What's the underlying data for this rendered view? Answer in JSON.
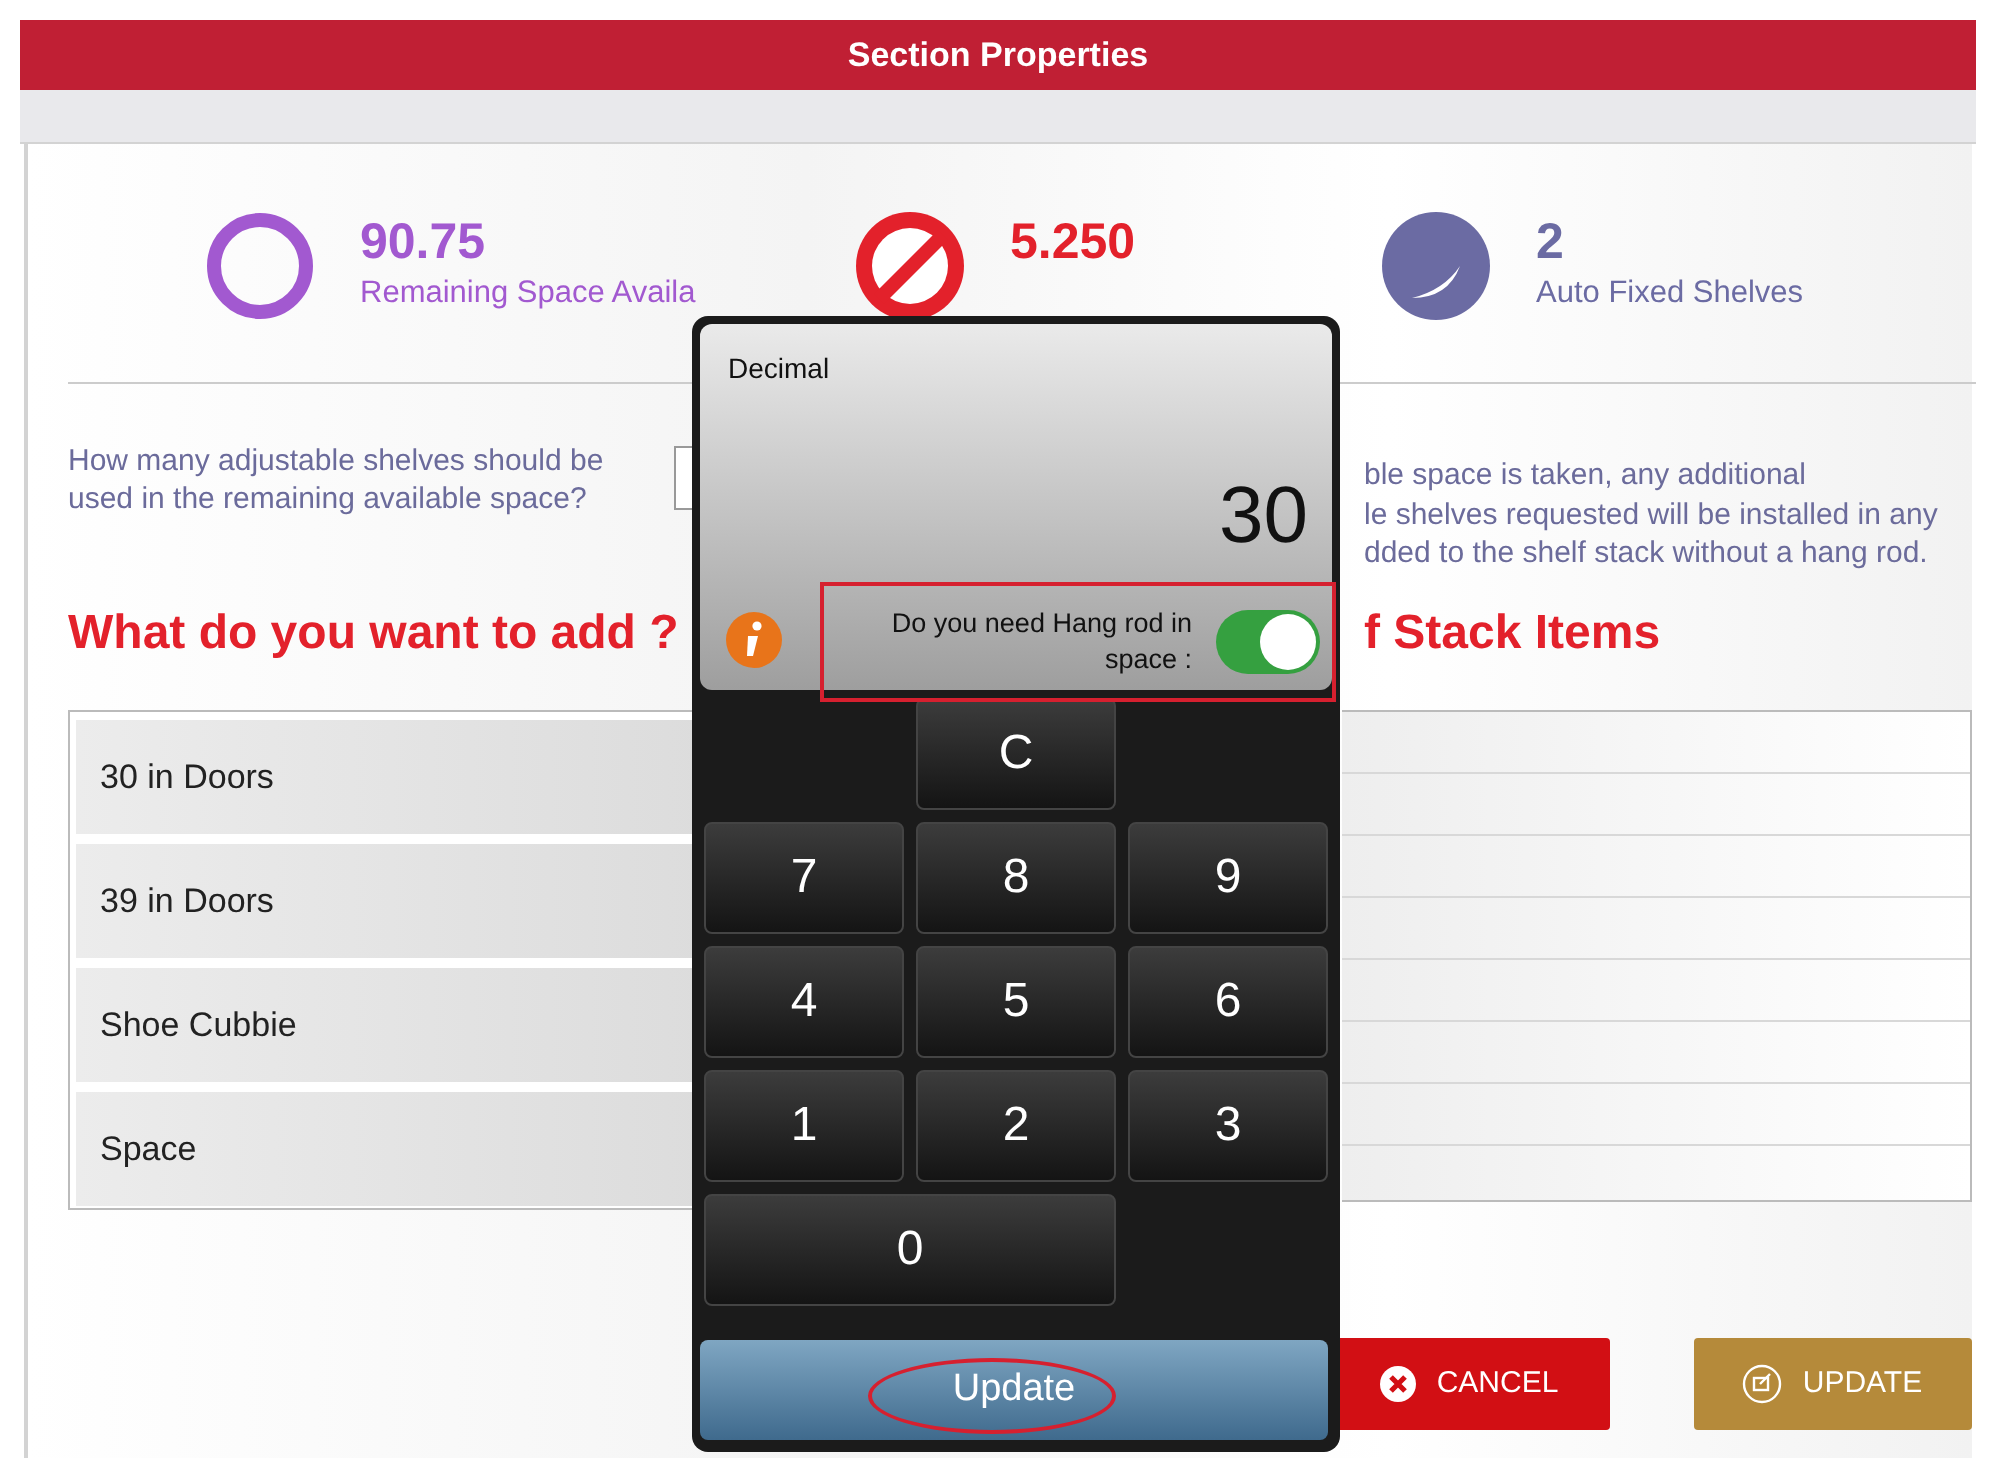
{
  "header": {
    "title": "Section Properties"
  },
  "stats": [
    {
      "kind": "ring",
      "value": "90.75",
      "label": "Remaining Space Availa",
      "color": "#a259d0"
    },
    {
      "kind": "slash",
      "value": "5.250",
      "color": "#e3212b"
    },
    {
      "kind": "pie",
      "value": "2",
      "label": "Auto Fixed Shelves",
      "color": "#6b6ba3"
    }
  ],
  "question": "How many adjustable shelves should be used in the remaining available space?",
  "note_lines": [
    "ble space is taken, any additional",
    "le shelves requested will be installed in any",
    "dded to the shelf stack without a hang rod."
  ],
  "headings": [
    "What do you want to add ?",
    "f Stack Items"
  ],
  "items": [
    "30 in Doors",
    "39 in Doors",
    "Shoe Cubbie",
    "Space"
  ],
  "buttons": [
    {
      "kind": "cancel",
      "label": "CANCEL"
    },
    {
      "kind": "update",
      "label": "UPDATE"
    }
  ],
  "keypad": {
    "mode": "Decimal",
    "display": "30",
    "toggle": {
      "label": "Do you need Hang rod in space :",
      "on": true
    },
    "keys": [
      "C",
      "7",
      "8",
      "9",
      "4",
      "5",
      "6",
      "1",
      "2",
      "3",
      "0"
    ],
    "submit": "Update"
  }
}
